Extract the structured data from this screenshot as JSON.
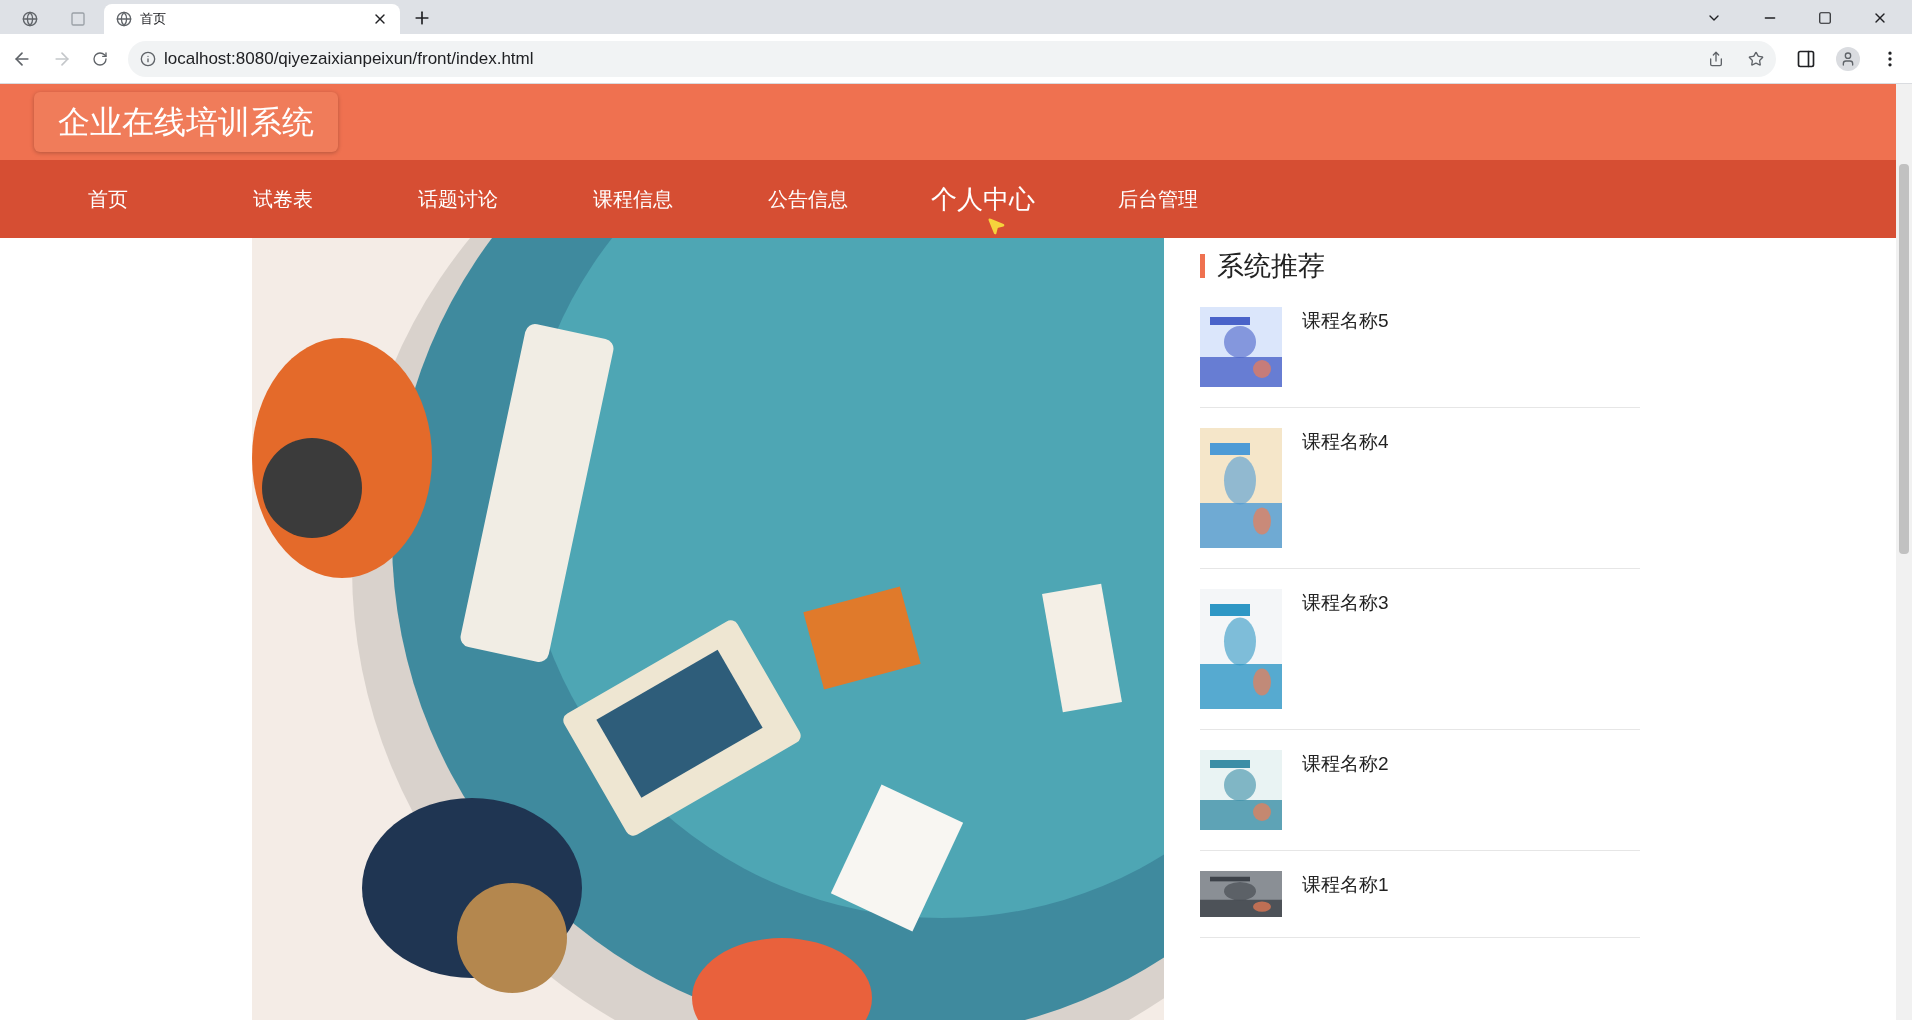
{
  "browser": {
    "tabs": [
      {
        "kind": "globe",
        "selected": false
      },
      {
        "kind": "blank",
        "selected": false
      },
      {
        "kind": "globe",
        "label": "首页",
        "selected": true
      }
    ],
    "address": "localhost:8080/qiyezaixianpeixun/front/index.html"
  },
  "site": {
    "title": "企业在线培训系统"
  },
  "nav": [
    {
      "label": "首页",
      "selected": false
    },
    {
      "label": "试卷表",
      "selected": false
    },
    {
      "label": "话题讨论",
      "selected": false
    },
    {
      "label": "课程信息",
      "selected": false
    },
    {
      "label": "公告信息",
      "selected": false
    },
    {
      "label": "个人中心",
      "selected": true
    },
    {
      "label": "后台管理",
      "selected": false
    }
  ],
  "recommend": {
    "heading": "系统推荐",
    "items": [
      {
        "name": "课程名称5",
        "kind": "short"
      },
      {
        "name": "课程名称4",
        "kind": "tall"
      },
      {
        "name": "课程名称3",
        "kind": "tall"
      },
      {
        "name": "课程名称2",
        "kind": "short"
      },
      {
        "name": "课程名称1",
        "kind": "wide"
      }
    ]
  }
}
